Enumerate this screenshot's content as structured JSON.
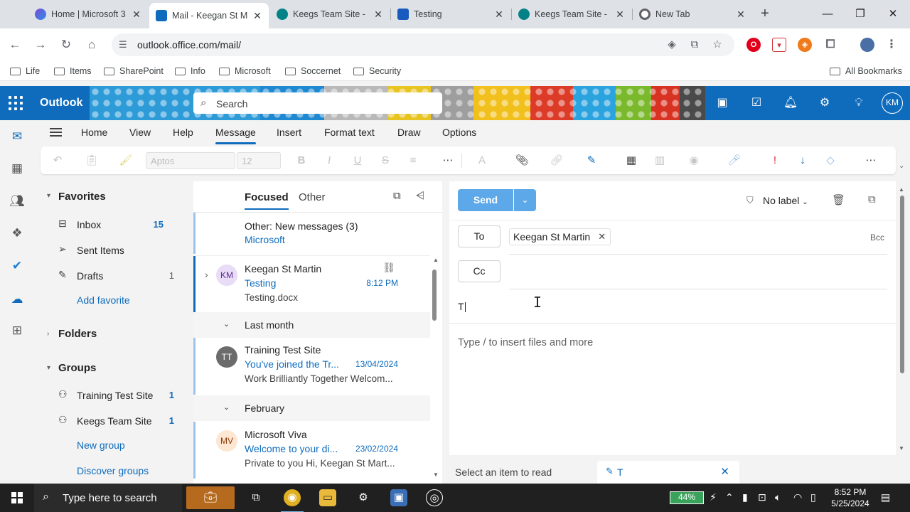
{
  "browser": {
    "tabs": [
      {
        "title": "Home | Microsoft 3",
        "color": "#7a4bd6"
      },
      {
        "title": "Mail - Keegan St M",
        "color": "#0f6cbd"
      },
      {
        "title": "Keegs Team Site -",
        "color": "#038387"
      },
      {
        "title": "Testing",
        "color": "#185abd"
      },
      {
        "title": "Keegs Team Site -",
        "color": "#038387"
      },
      {
        "title": "New Tab",
        "color": "#5f6368"
      }
    ],
    "url": "outlook.office.com/mail/",
    "bookmarks": [
      "Life",
      "Items",
      "SharePoint",
      "Info",
      "Microsoft",
      "Soccernet",
      "Security"
    ],
    "all_bookmarks": "All Bookmarks"
  },
  "outlook": {
    "app_name": "Outlook",
    "search_placeholder": "Search",
    "avatar": "KM",
    "ribbon_tabs": [
      "Home",
      "View",
      "Help",
      "Message",
      "Insert",
      "Format text",
      "Draw",
      "Options"
    ],
    "font_name": "Aptos",
    "font_size": "12"
  },
  "folders": {
    "favorites_title": "Favorites",
    "favorites": [
      {
        "label": "Inbox",
        "count": "15"
      },
      {
        "label": "Sent Items",
        "count": ""
      },
      {
        "label": "Drafts",
        "count": "1"
      }
    ],
    "add_favorite": "Add favorite",
    "folders_title": "Folders",
    "groups_title": "Groups",
    "groups": [
      {
        "label": "Training Test Site",
        "count": "1"
      },
      {
        "label": "Keegs Team Site",
        "count": "1"
      }
    ],
    "new_group": "New group",
    "discover_groups": "Discover groups"
  },
  "message_list": {
    "tab_focused": "Focused",
    "tab_other": "Other",
    "other_notice": "Other: New messages (3)",
    "other_sender": "Microsoft",
    "messages": [
      {
        "avatar": "KM",
        "sender": "Keegan St Martin",
        "subject": "Testing",
        "time": "8:12 PM",
        "preview": "Testing.docx",
        "avatar_bg": "#e8dcf6",
        "avatar_fg": "#5c2e91"
      }
    ],
    "groups": [
      {
        "label": "Last month",
        "items": [
          {
            "avatar": "TT",
            "sender": "Training Test Site",
            "subject": "You've joined the Tr...",
            "time": "13/04/2024",
            "preview": "Work Brilliantly Together Welcom...",
            "avatar_bg": "#6b6b6b",
            "avatar_fg": "#ffffff"
          }
        ]
      },
      {
        "label": "February",
        "items": [
          {
            "avatar": "MV",
            "sender": "Microsoft Viva",
            "subject": "Welcome to your di...",
            "time": "23/02/2024",
            "preview": "Private to you Hi, Keegan St Mart...",
            "avatar_bg": "#fde7d2",
            "avatar_fg": "#8a3707"
          }
        ]
      }
    ]
  },
  "compose": {
    "send": "Send",
    "label": "No label",
    "to_label": "To",
    "cc_label": "Cc",
    "bcc_label": "Bcc",
    "recipient": "Keegan St Martin",
    "subject": "T",
    "body_placeholder": "Type / to insert files and more"
  },
  "item_tabs": {
    "read": "Select an item to read",
    "draft": "T"
  },
  "taskbar": {
    "search": "Type here to search",
    "battery": "44%",
    "time": "8:52 PM",
    "date": "5/25/2024"
  }
}
